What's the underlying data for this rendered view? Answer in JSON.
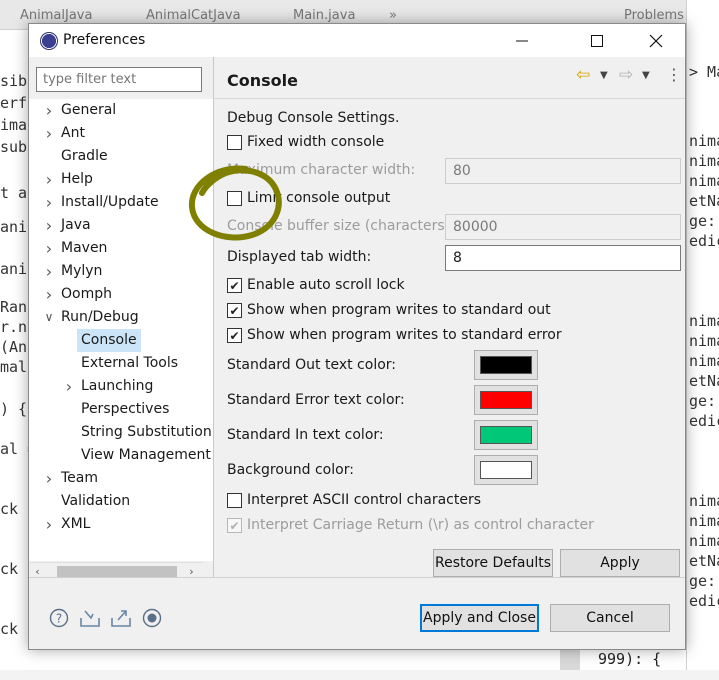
{
  "background": {
    "tabs": [
      "AnimalJava",
      "AnimalCatJava",
      "Main.java",
      "»",
      "Problems"
    ],
    "left_code": [
      "sibl",
      "erfl",
      "imal",
      "subc",
      "t an",
      "anin",
      " ani",
      "Rand",
      "r.ne",
      " (An",
      "mal)",
      ") {",
      "al =",
      "ck",
      "ck",
      "ck"
    ],
    "right_code": [
      "> Ma",
      "nima",
      "nima",
      "nima",
      "etNa",
      "ge:",
      "edic",
      "nima",
      "nima",
      "nima",
      "etNa",
      "ge:",
      "edic",
      "nima",
      "nima",
      "nima",
      "etNa",
      "ge:",
      "edic"
    ],
    "bottom_code": "999): {"
  },
  "dialog": {
    "title": "Preferences",
    "filter_placeholder": "type filter text",
    "tree": [
      {
        "label": "General",
        "expandable": true,
        "expanded": false,
        "level": 0
      },
      {
        "label": "Ant",
        "expandable": true,
        "expanded": false,
        "level": 0
      },
      {
        "label": "Gradle",
        "expandable": false,
        "expanded": false,
        "level": 0
      },
      {
        "label": "Help",
        "expandable": true,
        "expanded": false,
        "level": 0
      },
      {
        "label": "Install/Update",
        "expandable": true,
        "expanded": false,
        "level": 0
      },
      {
        "label": "Java",
        "expandable": true,
        "expanded": false,
        "level": 0
      },
      {
        "label": "Maven",
        "expandable": true,
        "expanded": false,
        "level": 0
      },
      {
        "label": "Mylyn",
        "expandable": true,
        "expanded": false,
        "level": 0
      },
      {
        "label": "Oomph",
        "expandable": true,
        "expanded": false,
        "level": 0
      },
      {
        "label": "Run/Debug",
        "expandable": true,
        "expanded": true,
        "level": 0
      },
      {
        "label": "Console",
        "expandable": false,
        "expanded": false,
        "level": 1,
        "selected": true
      },
      {
        "label": "External Tools",
        "expandable": false,
        "expanded": false,
        "level": 1
      },
      {
        "label": "Launching",
        "expandable": true,
        "expanded": false,
        "level": 1
      },
      {
        "label": "Perspectives",
        "expandable": false,
        "expanded": false,
        "level": 1
      },
      {
        "label": "String Substitution",
        "expandable": false,
        "expanded": false,
        "level": 1
      },
      {
        "label": "View Management",
        "expandable": false,
        "expanded": false,
        "level": 1
      },
      {
        "label": "Team",
        "expandable": true,
        "expanded": false,
        "level": 0
      },
      {
        "label": "Validation",
        "expandable": false,
        "expanded": false,
        "level": 0
      },
      {
        "label": "XML",
        "expandable": true,
        "expanded": false,
        "level": 0
      }
    ],
    "page": {
      "title": "Console",
      "section_label": "Debug Console Settings.",
      "fixed_width_console": {
        "label": "Fixed width console",
        "checked": false
      },
      "max_char_width": {
        "label": "Maximum character width:",
        "value": "80"
      },
      "limit_console_output": {
        "label": "Limit console output",
        "checked": false
      },
      "console_buffer_size": {
        "label": "Console buffer size (characters):",
        "value": "80000"
      },
      "displayed_tab_width": {
        "label": "Displayed tab width:",
        "value": "8"
      },
      "enable_auto_scroll_lock": {
        "label": "Enable auto scroll lock",
        "checked": true
      },
      "show_writes_stdout": {
        "label": "Show when program writes to standard out",
        "checked": true
      },
      "show_writes_stderr": {
        "label": "Show when program writes to standard error",
        "checked": true
      },
      "std_out_color": {
        "label": "Standard Out text color:",
        "color": "#000000"
      },
      "std_err_color": {
        "label": "Standard Error text color:",
        "color": "#ff0000"
      },
      "std_in_color": {
        "label": "Standard In text color:",
        "color": "#00c878"
      },
      "bg_color": {
        "label": "Background color:",
        "color": "#ffffff"
      },
      "interpret_ascii": {
        "label": "Interpret ASCII control characters",
        "checked": false
      },
      "interpret_cr": {
        "label": "Interpret Carriage Return (\\r) as control character",
        "checked": true
      },
      "restore_defaults": "Restore Defaults",
      "apply": "Apply"
    },
    "footer": {
      "apply_and_close": "Apply and Close",
      "cancel": "Cancel"
    }
  }
}
